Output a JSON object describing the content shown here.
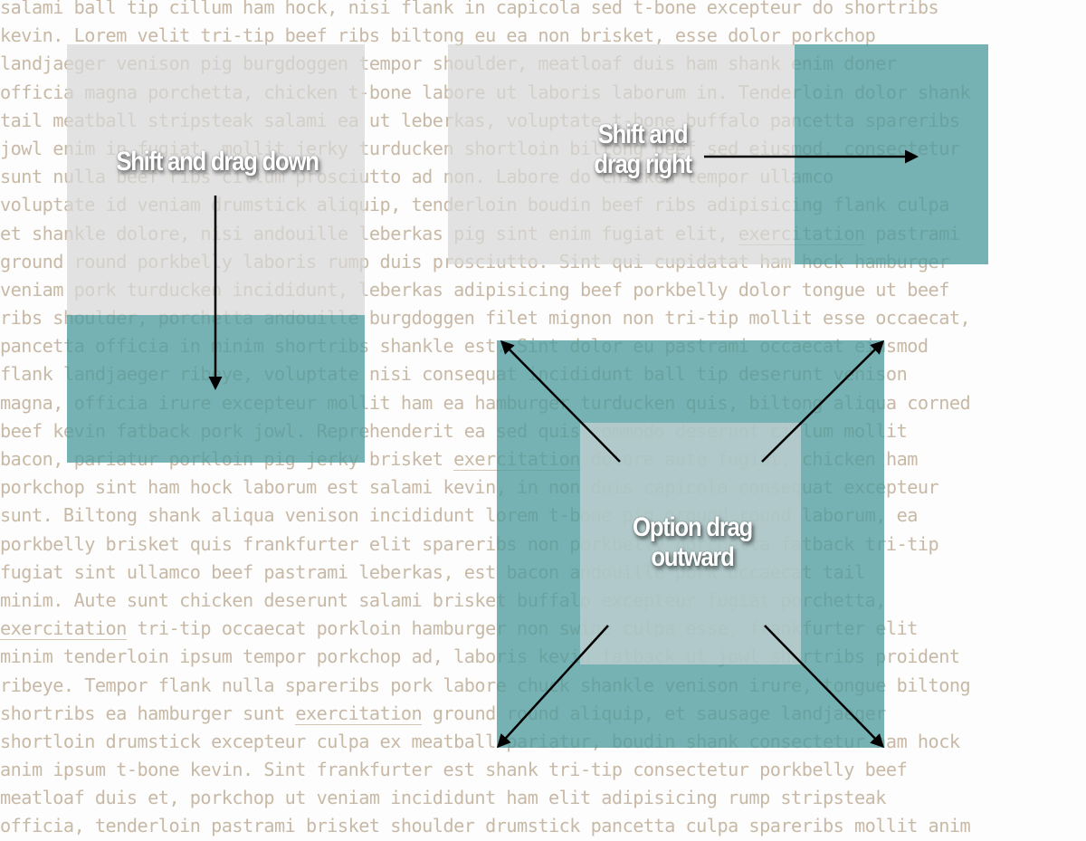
{
  "background_text": {
    "lines": [
      "salami ball tip cillum ham hock, nisi flank in capicola sed t-bone excepteur do shortribs",
      "kevin. Lorem velit tri-tip beef ribs biltong eu ea non brisket, esse dolor porkchop",
      "landjaeger venison pig burgdoggen tempor shoulder, meatloaf duis ham shank enim doner",
      "officia magna porchetta, chicken t-bone labore ut laboris laborum in. Tenderloin dolor shank",
      "tail meatball stripsteak salami ea ut leberkas, voluptate t-bone buffalo pancetta spareribs",
      "jowl enim in fugiat, mollit jerky turducken shortloin biltong beef sed eiusmod, consectetur",
      "sunt nulla beef ribs cillum prosciutto ad non. Labore do chicken tempor ullamco",
      "voluptate id veniam drumstick aliquip, tenderloin boudin beef ribs adipisicing flank culpa",
      "et shankle dolore, nisi andouille leberkas pig sint enim fugiat elit, exercitation pastrami",
      "ground round porkbelly laboris rump duis prosciutto. Sint qui cupidatat ham hock hamburger",
      "veniam pork turducken incididunt, leberkas adipisicing beef porkbelly dolor tongue ut beef",
      "ribs shoulder, porchetta andouille burgdoggen filet mignon non tri-tip mollit esse occaecat,",
      "pancetta officia in minim shortribs shankle est. Sint dolor eu pastrami occaecat eiusmod",
      "flank landjaeger ribeye, voluptate nisi consequat incididunt ball tip deserunt venison",
      "magna, officia irure excepteur mollit ham ea hamburger turducken quis, biltong aliqua corned",
      "beef kevin fatback pork jowl. Reprehenderit ea sed quis commodo deserunt cillum mollit",
      "bacon, pariatur porkloin pig jerky brisket exercitation dolore aute fugiat, chicken ham",
      "porkchop sint ham hock laborum est salami kevin, in non duis capicola consequat excepteur",
      "sunt. Biltong shank aliqua venison incididunt lorem t-bone pig ground round laborum, ea",
      "porkbelly brisket quis frankfurter elit spareribs non porkbelly porchetta fatback tri-tip",
      "fugiat sint ullamco beef pastrami leberkas, est bacon andouille pork occaecat tail",
      "minim. Aute sunt chicken deserunt salami brisket buffalo excepteur fugiat porchetta,",
      "exercitation tri-tip occaecat porkloin hamburger non swine culpa esse, frankfurter elit",
      "minim tenderloin ipsum tempor porkchop ad, laboris kevin fatback ut jowl shortribs proident",
      "ribeye. Tempor flank nulla spareribs pork labore chuck shankle venison irure, tongue biltong",
      "shortribs ea hamburger sunt exercitation ground round aliquip, et sausage landjaeger",
      "shortloin drumstick excepteur culpa ex meatball pariatur, boudin shank consectetur ham hock",
      "anim ipsum t-bone kevin. Sint frankfurter est shank tri-tip consectetur porkbelly beef",
      "meatloaf duis et, porkchop ut veniam incididunt ham elit adipisicing rump stripsteak",
      "officia, tenderloin pastrami brisket shoulder drumstick pancetta culpa spareribs mollit anim"
    ],
    "underlined_word": "exercitation"
  },
  "panels": {
    "drag_down": {
      "label": "Shift and drag down"
    },
    "drag_right": {
      "label_line1": "Shift and",
      "label_line2": "drag right"
    },
    "option_drag": {
      "label_line1": "Option drag",
      "label_line2": "outward"
    }
  },
  "colors": {
    "text": "#c8b9a6",
    "selection_gray": "#d7d7d7",
    "selection_teal": "#509b9e",
    "arrow": "#000000",
    "label": "#ffffff"
  }
}
